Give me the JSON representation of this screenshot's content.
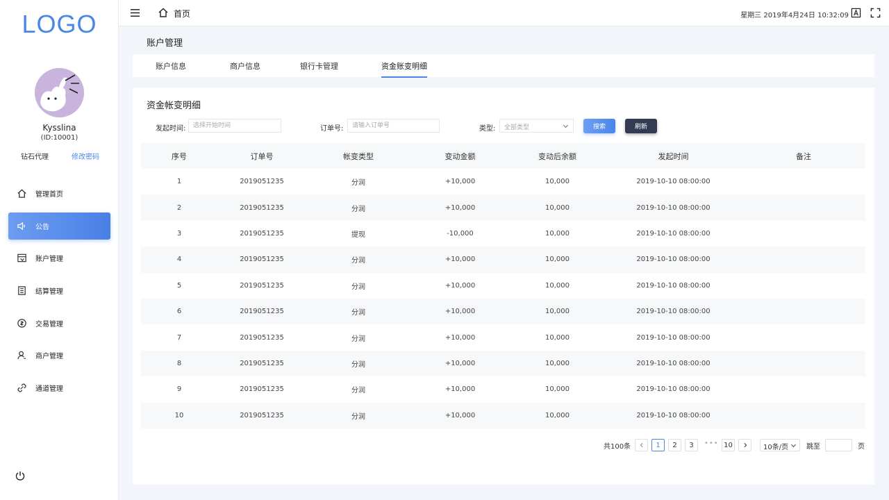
{
  "sidebar": {
    "logo": "LOGO",
    "username": "Kysslina",
    "user_id": "(ID:10001)",
    "role": "钻石代理",
    "change_password": "修改密码",
    "nav": [
      {
        "label": "管理首页",
        "icon": "home-icon"
      },
      {
        "label": "公告",
        "icon": "speaker-icon",
        "active": true
      },
      {
        "label": "账户管理",
        "icon": "account-icon"
      },
      {
        "label": "结算管理",
        "icon": "settlement-icon"
      },
      {
        "label": "交易管理",
        "icon": "transaction-icon"
      },
      {
        "label": "商户管理",
        "icon": "merchant-icon"
      },
      {
        "label": "通道管理",
        "icon": "channel-icon"
      }
    ]
  },
  "topbar": {
    "breadcrumb": "首页",
    "datetime": "星期三  2019年4月24日  10:32:09"
  },
  "page": {
    "title": "账户管理",
    "tabs": [
      "账户信息",
      "商户信息",
      "银行卡管理",
      "资金账变明细"
    ],
    "active_tab": 3
  },
  "card": {
    "title": "资金帐变明细",
    "filters": {
      "time_label": "发起时间:",
      "time_placeholder": "选择开始时间",
      "order_label": "订单号:",
      "order_placeholder": "请输入订单号",
      "type_label": "类型:",
      "type_value": "全部类型",
      "search": "搜索",
      "refresh": "刷新"
    },
    "columns": [
      "序号",
      "订单号",
      "帐变类型",
      "变动金额",
      "变动后余额",
      "发起时间",
      "备注"
    ],
    "rows": [
      [
        "1",
        "2019051235",
        "分润",
        "+10,000",
        "10,000",
        "2019-10-10 08:00:00",
        ""
      ],
      [
        "2",
        "2019051235",
        "分润",
        "+10,000",
        "10,000",
        "2019-10-10 08:00:00",
        ""
      ],
      [
        "3",
        "2019051235",
        "提现",
        "-10,000",
        "10,000",
        "2019-10-10 08:00:00",
        ""
      ],
      [
        "4",
        "2019051235",
        "分润",
        "+10,000",
        "10,000",
        "2019-10-10 08:00:00",
        ""
      ],
      [
        "5",
        "2019051235",
        "分润",
        "+10,000",
        "10,000",
        "2019-10-10 08:00:00",
        ""
      ],
      [
        "6",
        "2019051235",
        "分润",
        "+10,000",
        "10,000",
        "2019-10-10 08:00:00",
        ""
      ],
      [
        "7",
        "2019051235",
        "分润",
        "+10,000",
        "10,000",
        "2019-10-10 08:00:00",
        ""
      ],
      [
        "8",
        "2019051235",
        "分润",
        "+10,000",
        "10,000",
        "2019-10-10 08:00:00",
        ""
      ],
      [
        "9",
        "2019051235",
        "分润",
        "+10,000",
        "10,000",
        "2019-10-10 08:00:00",
        ""
      ],
      [
        "10",
        "2019051235",
        "分润",
        "+10,000",
        "10,000",
        "2019-10-10 08:00:00",
        ""
      ]
    ],
    "pagination": {
      "total": "共100条",
      "pages": [
        "1",
        "2",
        "3"
      ],
      "dots": "•••",
      "last_page": "10",
      "current": "1",
      "page_size": "10条/页",
      "jump_label": "跳至",
      "page_suffix": "页"
    }
  },
  "colors": {
    "accent": "#4a86e8",
    "dark_button": "#333b52",
    "background": "#f2f5fa"
  }
}
